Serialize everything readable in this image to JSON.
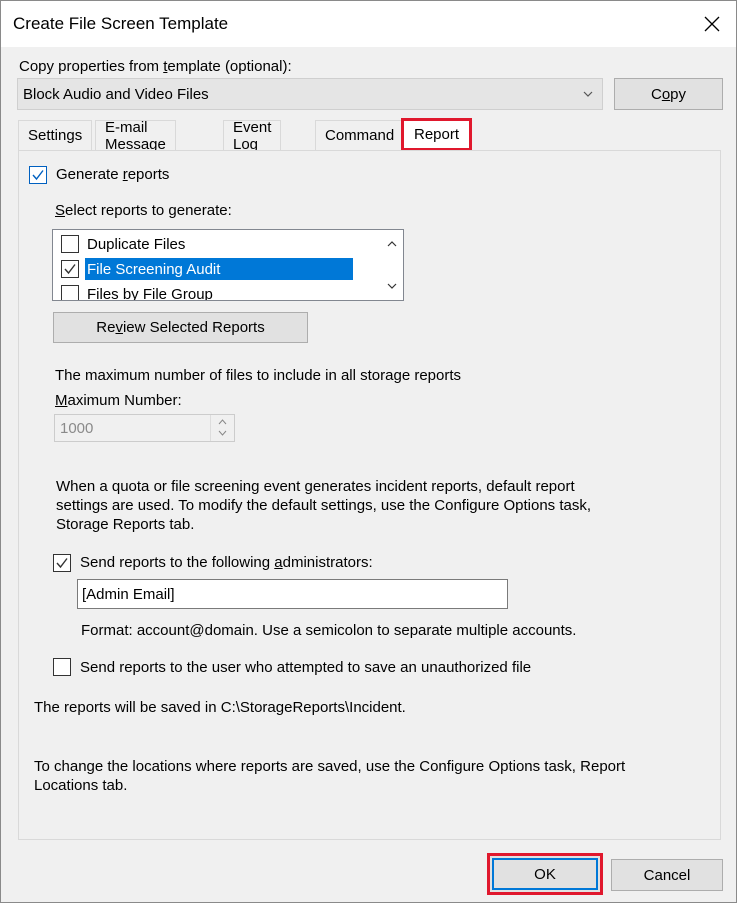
{
  "window": {
    "title": "Create File Screen Template"
  },
  "template": {
    "label_pre": "Copy properties from ",
    "label_key": "t",
    "label_post": "emplate (optional):",
    "selected_value": "Block Audio and Video Files",
    "copy_button_pre": "C",
    "copy_button_key": "o",
    "copy_button_post": "py"
  },
  "tabs": [
    {
      "label": "Settings"
    },
    {
      "label": "E-mail Message"
    },
    {
      "label": "Event Log"
    },
    {
      "label": "Command"
    },
    {
      "label": "Report",
      "active": true
    }
  ],
  "report": {
    "generate_reports": {
      "label_pre": "Generate ",
      "label_key": "r",
      "label_post": "eports",
      "checked": true
    },
    "select_label_key": "S",
    "select_label_post": "elect reports to generate:",
    "report_list": [
      {
        "label": "Duplicate Files",
        "checked": false,
        "selected": false
      },
      {
        "label": "File Screening Audit",
        "checked": true,
        "selected": true
      },
      {
        "label": "Files by File Group",
        "checked": false,
        "selected": false
      }
    ],
    "review_button_pre": "Re",
    "review_button_key": "v",
    "review_button_post": "iew Selected Reports",
    "max_files_text": "The maximum number of files to include in all storage reports",
    "max_number_label_key": "M",
    "max_number_label_post": "aximum Number:",
    "max_number_value": "1000",
    "incident_text_1": "When a quota or file screening event generates incident reports, default report",
    "incident_text_2": "settings are used. To modify the default settings, use the Configure Options task,",
    "incident_text_3": "Storage Reports tab.",
    "send_admins": {
      "label_pre": "Send reports to the following ",
      "label_key": "a",
      "label_post": "dministrators:",
      "checked": true
    },
    "admin_email_value": "[Admin Email]",
    "format_text": "Format: account@domain. Use a semicolon to separate multiple accounts.",
    "send_user": {
      "label": "Send reports to the user who attempted to save an unauthorized file",
      "checked": false
    },
    "saved_location_text": "The reports will be saved in C:\\StorageReports\\Incident.",
    "change_locations_text_1": "To change the locations where reports are saved, use the Configure Options task, Report",
    "change_locations_text_2": "Locations tab."
  },
  "footer": {
    "ok_label": "OK",
    "cancel_label": "Cancel"
  },
  "colors": {
    "highlight_red": "#e0182d",
    "selection_blue": "#0078d7"
  }
}
